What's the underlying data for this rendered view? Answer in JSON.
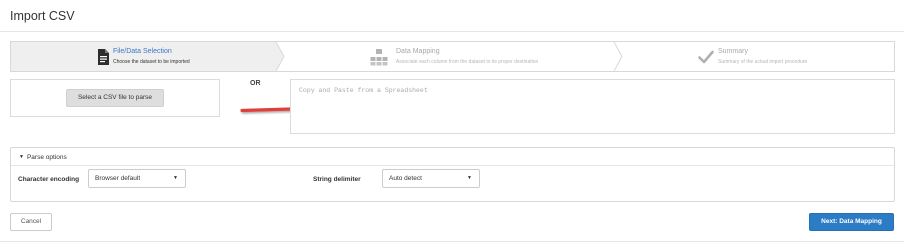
{
  "page": {
    "title": "Import CSV"
  },
  "wizard": {
    "steps": [
      {
        "label": "File/Data Selection",
        "description": "Choose the dataset to be imported",
        "icon": "file-icon",
        "active": true
      },
      {
        "label": "Data Mapping",
        "description": "Associate each column from the dataset to its proper destination",
        "icon": "data-mapping-icon",
        "active": false
      },
      {
        "label": "Summary",
        "description": "Summary of the actual import procedure",
        "icon": "checkmark-icon",
        "active": false
      }
    ]
  },
  "file_select": {
    "button_label": "Select a CSV file to parse"
  },
  "separator": {
    "or_label": "OR"
  },
  "paste_area": {
    "placeholder": "Copy and Paste from a Spreadsheet",
    "value": ""
  },
  "parse_options": {
    "title": "Parse options",
    "character_encoding": {
      "label": "Character encoding",
      "value": "Browser default"
    },
    "string_delimiter": {
      "label": "String delimiter",
      "value": "Auto detect"
    }
  },
  "footer": {
    "cancel_label": "Cancel",
    "next_label": "Next: Data Mapping"
  },
  "colors": {
    "accent": "#2b7bc5",
    "active_step_label": "#3a78c4",
    "arrow": "#e0413a"
  }
}
